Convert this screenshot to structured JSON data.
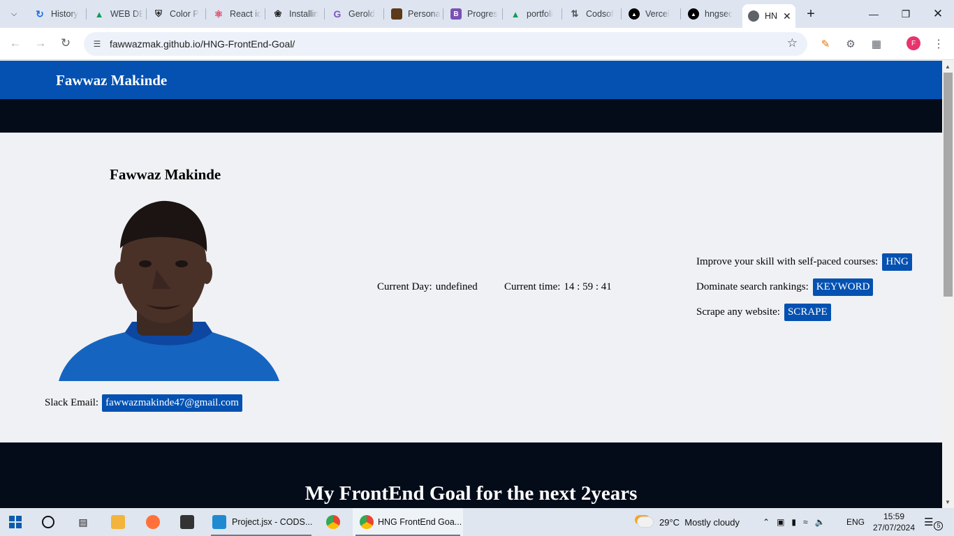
{
  "browser": {
    "tabs": [
      {
        "label": "History",
        "icon": "history-icon",
        "color": "#1a73e8"
      },
      {
        "label": "WEB DE",
        "icon": "drive-icon",
        "color": "#0f9d58"
      },
      {
        "label": "Color P",
        "icon": "shield-icon",
        "color": "#222222"
      },
      {
        "label": "React ic",
        "icon": "react-icon",
        "color": "#e4405f"
      },
      {
        "label": "Installin",
        "icon": "openai-icon",
        "color": "#222222"
      },
      {
        "label": "Gerold",
        "icon": "g-icon",
        "color": "#7e57c2"
      },
      {
        "label": "Persona",
        "icon": "portrait-icon",
        "color": "#5d3a1a"
      },
      {
        "label": "Progres",
        "icon": "bootstrap-icon",
        "color": "#7952b3"
      },
      {
        "label": "portfoli",
        "icon": "drive-icon",
        "color": "#0f9d58"
      },
      {
        "label": "Codsof",
        "icon": "sliders-icon",
        "color": "#555555"
      },
      {
        "label": "Vercel",
        "icon": "vercel-icon",
        "color": "#000000"
      },
      {
        "label": "hngsec",
        "icon": "vercel-icon",
        "color": "#000000"
      }
    ],
    "active_tab": {
      "label": "HN"
    },
    "url": "fawwazmak.github.io/HNG-FrontEnd-Goal/"
  },
  "page": {
    "header_title": "Fawwaz Makinde",
    "profile_name": "Fawwaz Makinde",
    "slack_label": "Slack Email:",
    "slack_email": "fawwazmakinde47@gmail.com",
    "day_label": "Current Day:",
    "day_value": "undefined",
    "time_label": "Current time:",
    "time_value": "14 : 59 : 41",
    "ctas": [
      {
        "text": "Improve your skill with self-paced courses:",
        "button": "HNG"
      },
      {
        "text": "Dominate search rankings:",
        "button": "KEYWORD"
      },
      {
        "text": "Scrape any website:",
        "button": "SCRAPE"
      }
    ],
    "goal_title": "My FrontEnd Goal for the next 2years",
    "colors": {
      "header": "#0451b1",
      "dark": "#050c19",
      "pill": "#0451b1"
    }
  },
  "taskbar": {
    "apps": [
      {
        "label": "Project.jsx - CODS...",
        "icon": "vscode-icon"
      },
      {
        "label": "HNG FrontEnd Goa...",
        "icon": "chrome-icon"
      }
    ],
    "weather": "29°C  Mostly cloudy",
    "lang": "ENG",
    "time": "15:59",
    "date": "27/07/2024",
    "notifications": "5"
  }
}
